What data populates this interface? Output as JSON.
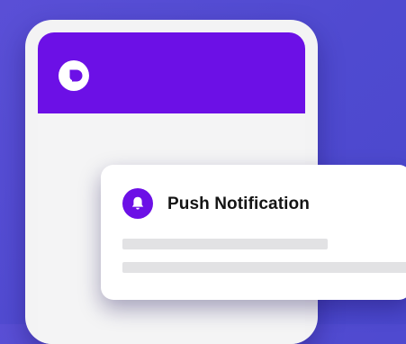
{
  "notification": {
    "title": "Push Notification",
    "icon": "bell-icon"
  },
  "app": {
    "logo": "app-logo-icon"
  },
  "colors": {
    "background": "#5a4fd6",
    "brand": "#6c10e6",
    "card": "#ffffff",
    "placeholder": "#e2e2e4"
  }
}
